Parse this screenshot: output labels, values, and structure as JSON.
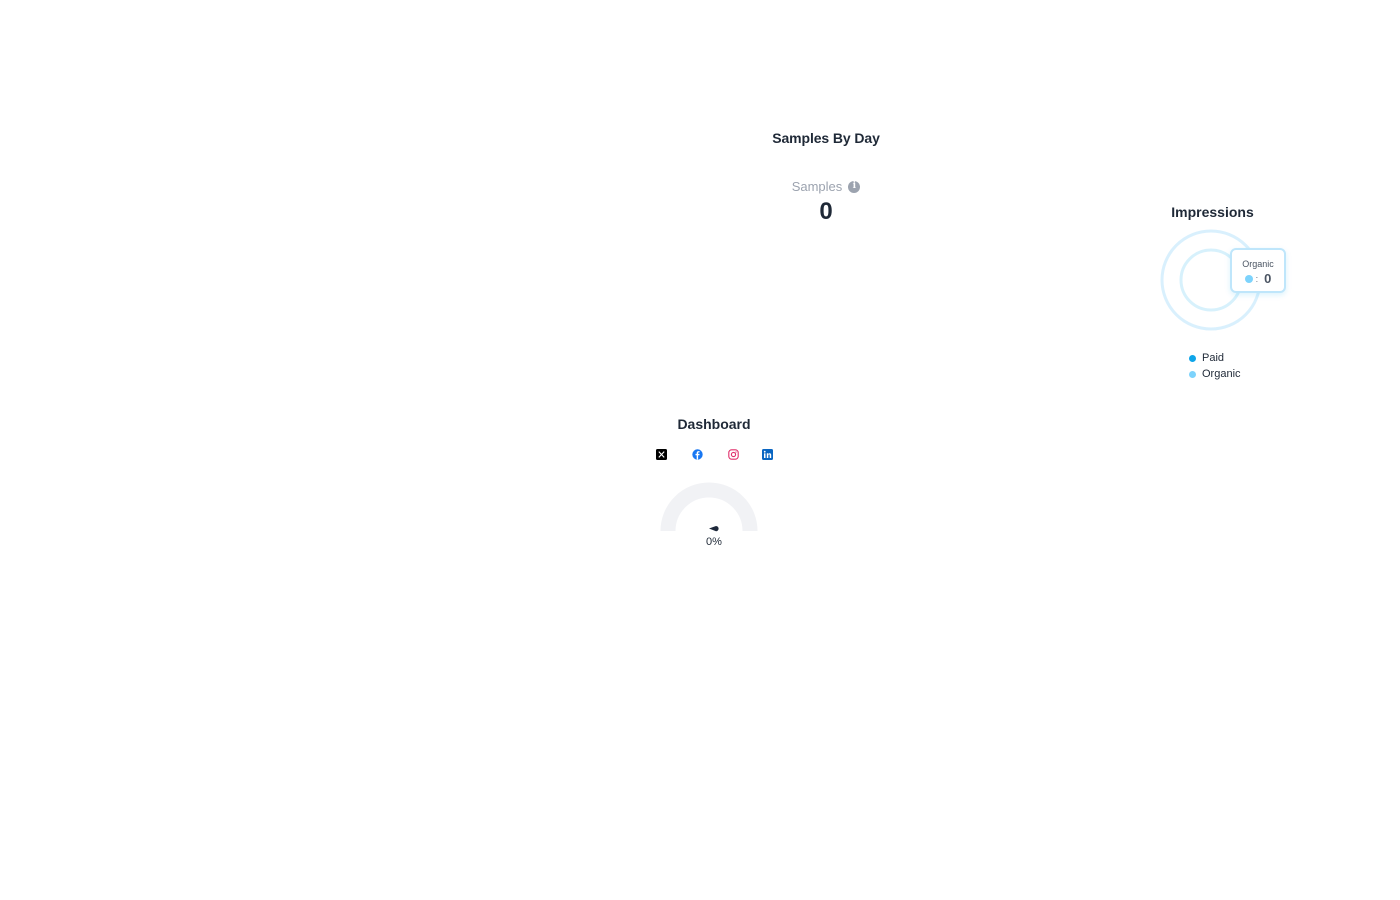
{
  "samples_by_day": {
    "title": "Samples By Day",
    "metric_label": "Samples",
    "metric_value": "0",
    "info_icon": "info-icon"
  },
  "impressions": {
    "title": "Impressions",
    "tooltip": {
      "label": "Organic",
      "separator": ":",
      "value": "0"
    },
    "legend": [
      {
        "label": "Paid",
        "color": "#0ea5e9"
      },
      {
        "label": "Organic",
        "color": "#7dd3fc"
      }
    ],
    "chart_data": {
      "type": "pie",
      "series": [
        {
          "name": "Paid",
          "values": [
            0
          ]
        },
        {
          "name": "Organic",
          "values": [
            0
          ]
        }
      ]
    }
  },
  "dashboard": {
    "title": "Dashboard",
    "social_icons": [
      {
        "name": "x-icon",
        "color": "#000000"
      },
      {
        "name": "facebook-icon",
        "color": "#1877f2"
      },
      {
        "name": "instagram-icon",
        "color": "#e1306c"
      },
      {
        "name": "linkedin-icon",
        "color": "#0a66c2"
      }
    ],
    "gauge": {
      "value": 0,
      "label": "0%"
    }
  },
  "colors": {
    "text_primary": "#1f2937",
    "text_muted": "#9ca3af",
    "paid": "#0ea5e9",
    "organic": "#7dd3fc",
    "gauge_track": "#f1f2f5",
    "gauge_needle": "#1e293b"
  }
}
